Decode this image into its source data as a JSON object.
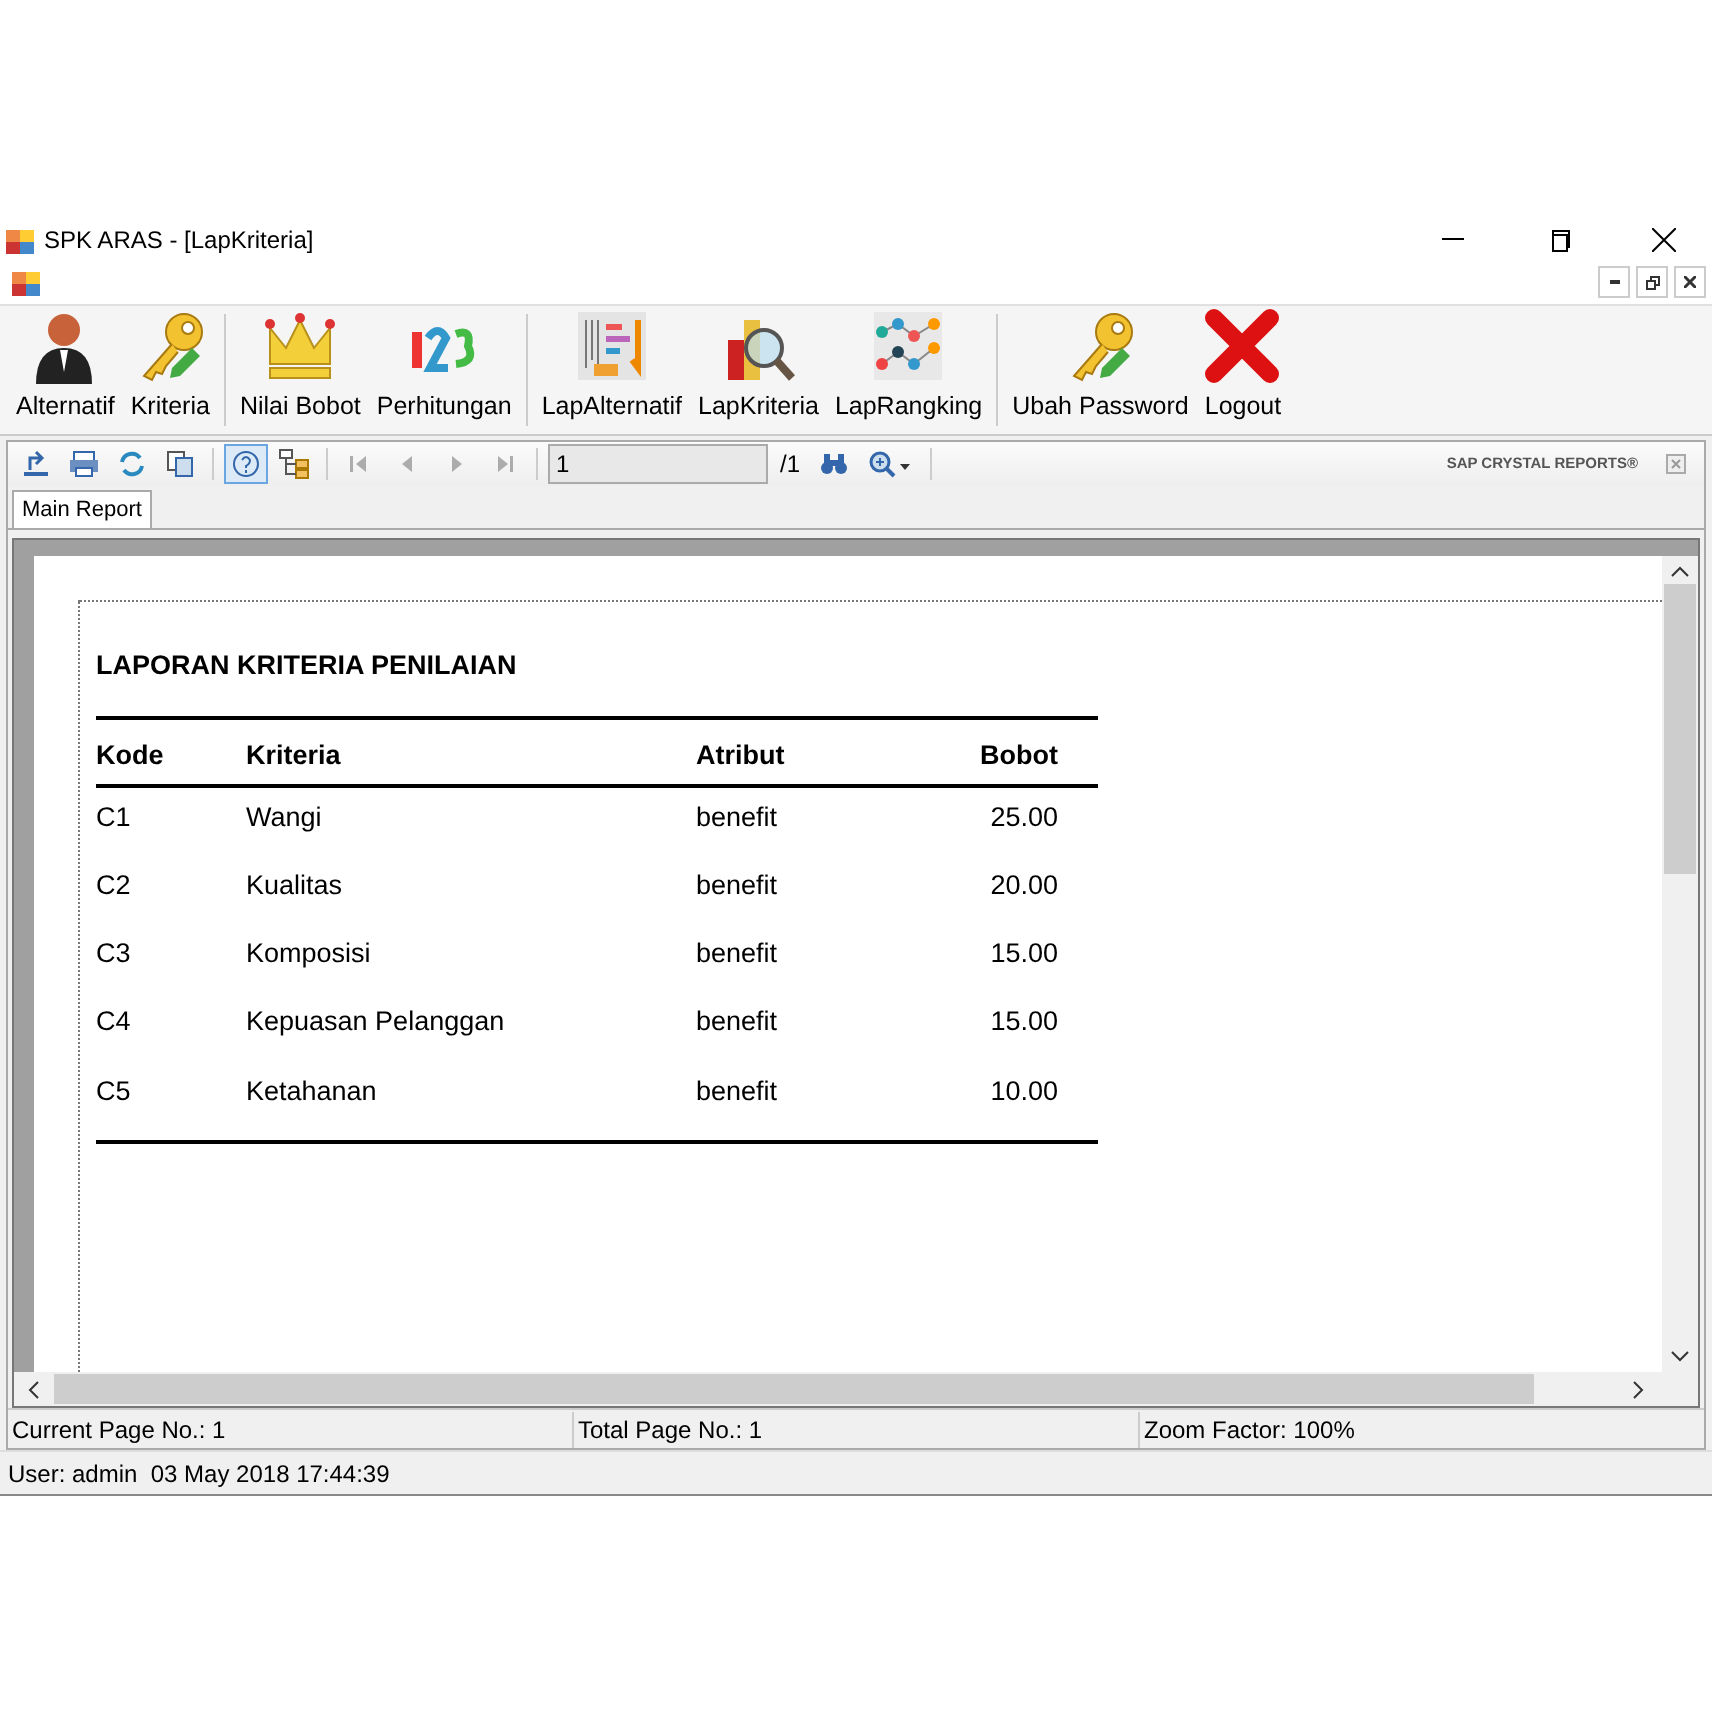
{
  "window": {
    "title": "SPK ARAS - [LapKriteria]"
  },
  "toolbar": {
    "groups": [
      [
        {
          "label": "Alternatif"
        },
        {
          "label": "Kriteria"
        }
      ],
      [
        {
          "label": "Nilai Bobot"
        },
        {
          "label": "Perhitungan"
        }
      ],
      [
        {
          "label": "LapAlternatif"
        },
        {
          "label": "LapKriteria"
        },
        {
          "label": "LapRangking"
        }
      ],
      [
        {
          "label": "Ubah Password"
        },
        {
          "label": "Logout"
        }
      ]
    ]
  },
  "viewer_toolbar": {
    "tools": [
      {
        "selected": false
      },
      {
        "selected": false
      },
      {
        "selected": false
      },
      {
        "selected": false
      },
      {
        "selected": true
      },
      {
        "selected": false
      }
    ],
    "nav": [
      {
        "disabled": true
      },
      {
        "disabled": true
      },
      {
        "disabled": true
      },
      {
        "disabled": true
      }
    ],
    "page_field": "1",
    "page_total": "/1",
    "brand": "SAP CRYSTAL REPORTS®"
  },
  "tabs": [
    {
      "label": "Main Report",
      "selected": true
    }
  ],
  "report": {
    "title": "LAPORAN KRITERIA PENILAIAN",
    "columns": [
      "Kode",
      "Kriteria",
      "Atribut",
      "Bobot"
    ],
    "rows": [
      [
        "C1",
        "Wangi",
        "benefit",
        "25.00"
      ],
      [
        "C2",
        "Kualitas",
        "benefit",
        "20.00"
      ],
      [
        "C3",
        "Komposisi",
        "benefit",
        "15.00"
      ],
      [
        "C4",
        "Kepuasan Pelanggan",
        "benefit",
        "15.00"
      ],
      [
        "C5",
        "Ketahanan",
        "benefit",
        "10.00"
      ]
    ]
  },
  "viewer_status": [
    "Current Page No.: 1",
    "Total Page No.: 1",
    "Zoom Factor: 100%"
  ],
  "status_bar": "User: admin  03 May 2018 17:44:39"
}
